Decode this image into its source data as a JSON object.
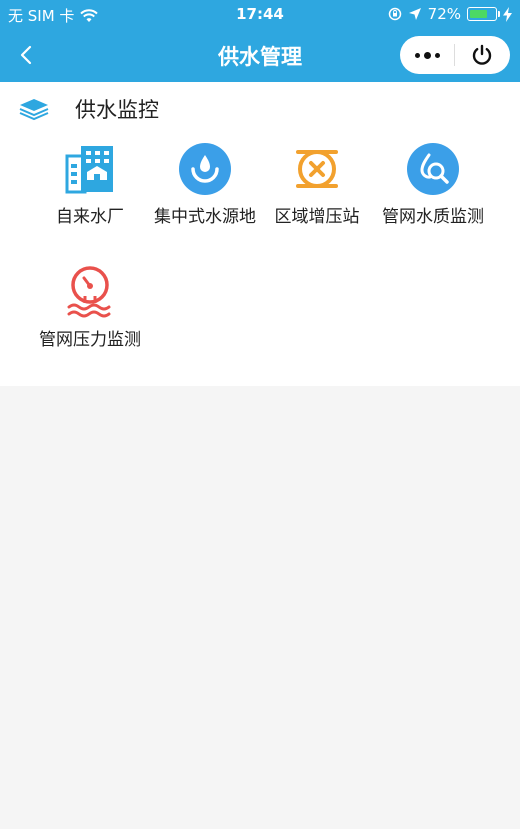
{
  "status_bar": {
    "carrier": "无 SIM 卡",
    "time": "17:44",
    "battery_percent": "72%",
    "battery_level": 0.72,
    "wifi_icon": "wifi-icon",
    "location_icon": "location-arrow-icon",
    "lock_icon": "orientation-lock-icon",
    "charging_icon": "charging-bolt-icon"
  },
  "nav": {
    "title": "供水管理",
    "back_icon": "chevron-left-icon",
    "more_icon": "more-dots-icon",
    "close_icon": "power-icon"
  },
  "section": {
    "title": "供水监控",
    "icon": "layers-icon"
  },
  "items": [
    {
      "label": "自来水厂",
      "icon": "water-plant-building-icon",
      "color": "#2ea7e0"
    },
    {
      "label": "集中式水源地",
      "icon": "water-source-drop-icon",
      "color": "#3b9fe8"
    },
    {
      "label": "区域增压站",
      "icon": "booster-pump-icon",
      "color": "#f2a12e"
    },
    {
      "label": "管网水质监测",
      "icon": "water-quality-magnifier-icon",
      "color": "#3b9fe8"
    },
    {
      "label": "管网压力监测",
      "icon": "pressure-gauge-icon",
      "color": "#e9514c"
    }
  ],
  "colors": {
    "primary": "#2ea7e0",
    "background": "#f5f5f5",
    "panel": "#ffffff",
    "battery_fill": "#4cd964"
  }
}
